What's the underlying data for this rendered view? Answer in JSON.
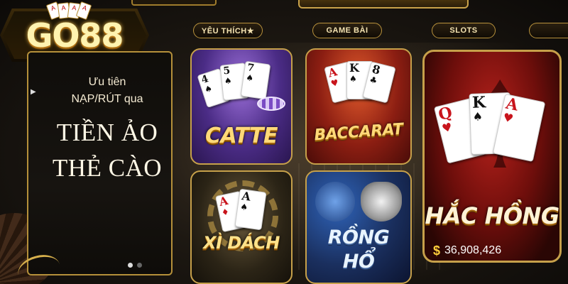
{
  "logo": {
    "text": "GO88",
    "card_icons": [
      "A",
      "A",
      "A",
      "A"
    ]
  },
  "tabs": [
    {
      "label": "YÊU THÍCH★"
    },
    {
      "label": "GAME BÀI"
    },
    {
      "label": "SLOTS"
    },
    {
      "label": ""
    }
  ],
  "promo": {
    "line1": "Ưu tiên",
    "line2": "NẠP/RÚT qua",
    "big1": "TIỀN ẢO",
    "big2": "THẺ CÀO",
    "arrow": "▶",
    "page_count": 2,
    "active_page": 1
  },
  "games": {
    "catte": {
      "label": "CATTE",
      "cards": [
        "4",
        "5",
        "7"
      ]
    },
    "baccarat": {
      "label": "BACCARAT",
      "cards": [
        "A",
        "K",
        "8"
      ]
    },
    "xidach": {
      "label": "XÌ DÁCH",
      "cards": [
        "A",
        "A"
      ]
    },
    "ronghổ": {
      "label_line1": "RỒNG",
      "label_line2": "HỔ"
    },
    "hachong": {
      "label": "HẮC HỒNG",
      "cards": [
        "Q",
        "K",
        "A"
      ],
      "jackpot_symbol": "$",
      "jackpot": "36,908,426"
    }
  },
  "colors": {
    "gold": "#c6a04a",
    "catte": "#4b2c86",
    "baccarat": "#8c1e12",
    "hachong": "#6e0e0b",
    "ronghổ": "#1a2f5e"
  }
}
